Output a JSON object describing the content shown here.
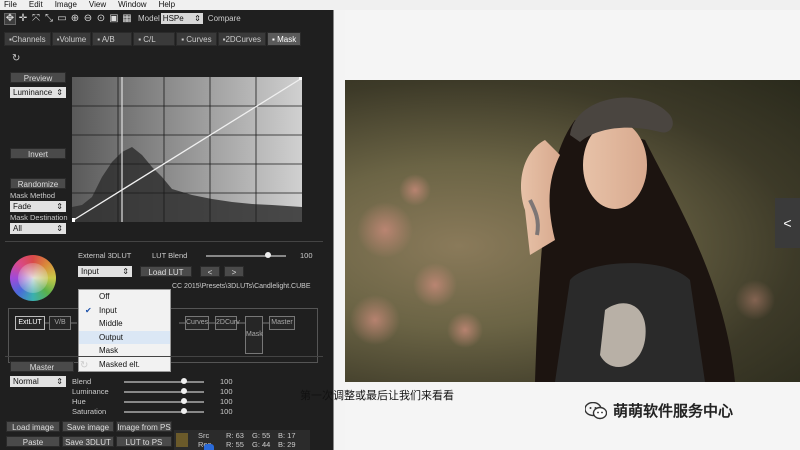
{
  "menubar": {
    "items": [
      "File",
      "Edit",
      "Image",
      "View",
      "Window",
      "Help"
    ]
  },
  "toolbar": {
    "icons": [
      "move-icon",
      "crosshair-icon",
      "fit-icon",
      "resize-icon",
      "select-icon",
      "zoom-in-icon",
      "zoom-out-icon",
      "zoom-fit-icon",
      "view-icon",
      "grid-icon"
    ],
    "model_label": "Model",
    "model_value": "HSPe",
    "compare_label": "Compare"
  },
  "tabs": [
    {
      "label": "Channels"
    },
    {
      "label": "Volume"
    },
    {
      "label": "A/B"
    },
    {
      "label": "C/L"
    },
    {
      "label": "Curves"
    },
    {
      "label": "2DCurves"
    },
    {
      "label": "Mask",
      "active": true
    }
  ],
  "mask_panel": {
    "preview_label": "Preview",
    "channel_value": "Luminance",
    "invert_label": "Invert",
    "randomize_label": "Randomize",
    "mask_method_label": "Mask Method",
    "mask_method_value": "Fade",
    "mask_destination_label": "Mask Destination",
    "mask_destination_value": "All"
  },
  "lut": {
    "external_label": "External 3DLUT",
    "blend_label": "LUT Blend",
    "blend_value": "100",
    "blend_level": 0.78,
    "input_select_value": "Input",
    "load_lut_label": "Load LUT",
    "prev_label": "<",
    "next_label": ">",
    "path_text": "CC 2015\\Presets\\3DLUTs\\Candlelight.CUBE"
  },
  "dropdown": {
    "items": [
      {
        "label": "Off",
        "checked": false
      },
      {
        "label": "Input",
        "checked": true
      },
      {
        "label": "Middle",
        "checked": false
      },
      {
        "label": "Output",
        "checked": false,
        "hover": true
      },
      {
        "label": "Mask",
        "checked": false
      },
      {
        "label": "Masked elt.",
        "checked": false
      }
    ]
  },
  "flow": {
    "nodes": [
      "ExtLUT",
      "V/B",
      "Curves",
      "2DCurv",
      "Mask",
      "Master"
    ]
  },
  "master": {
    "master_label": "Master",
    "mode_value": "Normal",
    "sliders": [
      {
        "label": "Blend",
        "value": "100",
        "level": 1.0
      },
      {
        "label": "Luminance",
        "value": "100",
        "level": 1.0
      },
      {
        "label": "Hue",
        "value": "100",
        "level": 1.0
      },
      {
        "label": "Saturation",
        "value": "100",
        "level": 1.0
      }
    ]
  },
  "bottom_buttons": {
    "load_image": "Load image",
    "save_image": "Save image",
    "image_from_ps": "Image from PS",
    "paste": "Paste",
    "save_3dlut": "Save 3DLUT",
    "lut_to_ps": "LUT to PS"
  },
  "status": {
    "src_label": "Src",
    "res_label": "Res",
    "src": {
      "R": "63",
      "G": "55",
      "B": "17"
    },
    "res": {
      "R": "55",
      "G": "44",
      "B": "29"
    }
  },
  "video": {
    "subtitle": "第一次调整或最后让我们来看看",
    "watermark": "萌萌软件服务中心",
    "nav_arrow": "<"
  },
  "colors": {
    "panel_bg": "#1f1f1f",
    "accent": "#2a6ad9"
  }
}
